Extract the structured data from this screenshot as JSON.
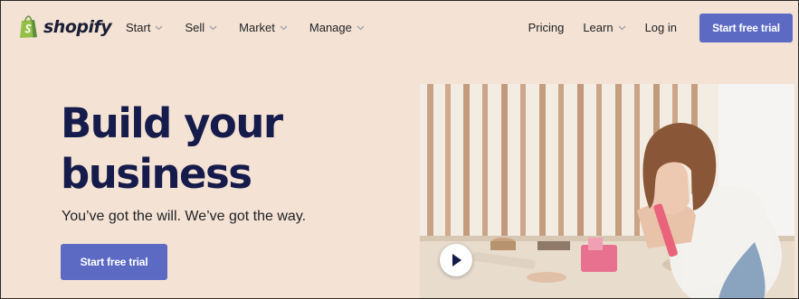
{
  "brand": {
    "name": "shopify",
    "logo_icon": "shopping-bag-icon",
    "color": "#95bf47"
  },
  "nav": {
    "left_items": [
      {
        "label": "Start",
        "has_dropdown": true
      },
      {
        "label": "Sell",
        "has_dropdown": true
      },
      {
        "label": "Market",
        "has_dropdown": true
      },
      {
        "label": "Manage",
        "has_dropdown": true
      }
    ],
    "right_items": [
      {
        "label": "Pricing",
        "has_dropdown": false
      },
      {
        "label": "Learn",
        "has_dropdown": true
      },
      {
        "label": "Log in",
        "has_dropdown": false
      }
    ],
    "cta_label": "Start free trial"
  },
  "hero": {
    "title": "Build your business",
    "subtitle": "You’ve got the will. We’ve got the way.",
    "cta_label": "Start free trial",
    "video": {
      "play_icon": "play-icon"
    }
  },
  "colors": {
    "background": "#f4e2d4",
    "accent": "#5c6ac4",
    "heading": "#151b4a"
  }
}
